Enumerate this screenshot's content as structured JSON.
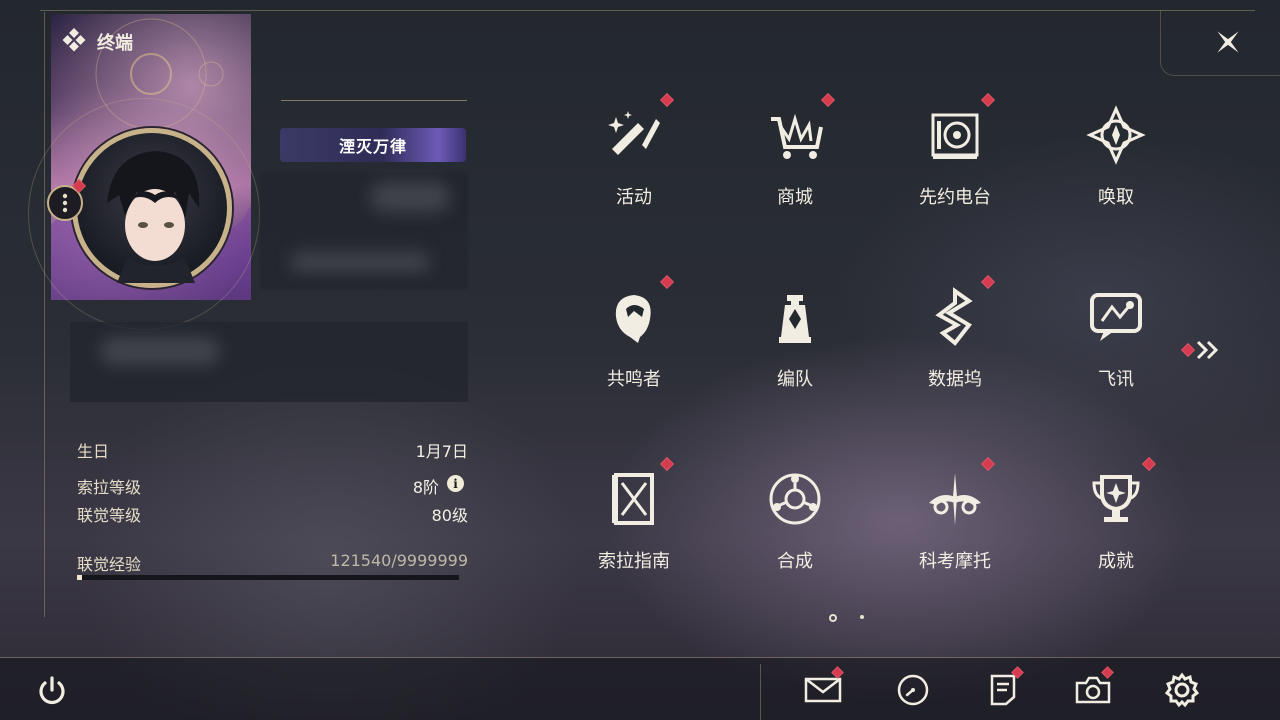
{
  "header": {
    "title": "终端",
    "title_icon": "diamond-cluster-icon",
    "close_icon": "star-close-icon"
  },
  "profile": {
    "title_badge": "湮灭万律",
    "stats": [
      {
        "label": "生日",
        "value": "1月7日"
      },
      {
        "label": "索拉等级",
        "value": "8阶"
      },
      {
        "label": "联觉等级",
        "value": "80级"
      }
    ],
    "experience": {
      "label": "联觉经验",
      "value": "121540/9999999",
      "progress": 0.012
    }
  },
  "menu": {
    "items": [
      {
        "label": "活动",
        "icon": "activity-icon",
        "badge": true
      },
      {
        "label": "商城",
        "icon": "shop-cart-icon",
        "badge": true
      },
      {
        "label": "先约电台",
        "icon": "radio-icon",
        "badge": true
      },
      {
        "label": "唤取",
        "icon": "convene-icon",
        "badge": false
      },
      {
        "label": "共鸣者",
        "icon": "resonator-icon",
        "badge": true
      },
      {
        "label": "编队",
        "icon": "team-icon",
        "badge": false
      },
      {
        "label": "数据坞",
        "icon": "data-bank-icon",
        "badge": true
      },
      {
        "label": "飞讯",
        "icon": "message-icon",
        "badge": false
      },
      {
        "label": "索拉指南",
        "icon": "guide-icon",
        "badge": true
      },
      {
        "label": "合成",
        "icon": "synthesis-icon",
        "badge": false
      },
      {
        "label": "科考摩托",
        "icon": "motorcycle-icon",
        "badge": true
      },
      {
        "label": "成就",
        "icon": "trophy-icon",
        "badge": true
      }
    ],
    "pages": {
      "current": 1,
      "total": 2
    }
  },
  "bottom_bar": {
    "icons": [
      "power-icon",
      "mail-icon",
      "clock-icon",
      "notice-icon",
      "camera-icon",
      "settings-icon"
    ]
  },
  "colors": {
    "accent_gold": "#c7b28a",
    "badge_red": "#d63b4f",
    "text": "#f2ede2"
  }
}
